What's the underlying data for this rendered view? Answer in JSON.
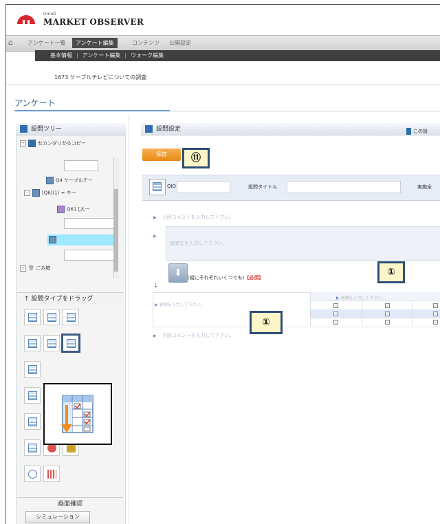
{
  "header": {
    "brand_small": "GmoD",
    "brand": "MARKET OBSERVER"
  },
  "nav": {
    "home_icon": "home-icon",
    "tabs": [
      {
        "label": "アンケート一覧",
        "active": false
      },
      {
        "label": "アンケート編集",
        "active": true
      },
      {
        "label": "コンテンツ",
        "active": false
      },
      {
        "label": "公開設定",
        "active": false
      }
    ],
    "subnav": [
      "基本情報",
      "アンケート編集",
      "ウォーク編集"
    ]
  },
  "survey_title": "1673 ケーブルテレビについての調査",
  "section_title": "アンケート",
  "left": {
    "tree_header": "設問ツリー",
    "copy_label": "セカンダリからコピー",
    "tree_items": [
      "Q4 ケーブルテー",
      "[Q6](1) = キー",
      "Q61 [大一"
    ],
    "trash_label": "ごみ箱",
    "drag_header": "設問タイプをドラッグ",
    "confirm_header": "画面確認",
    "simulation_button": "シミュレーション"
  },
  "right": {
    "header": "設問設定",
    "side_link": "この設",
    "save_label": "保存",
    "qid_label": "QID",
    "qtitle_label": "設問タイトル",
    "all_label": "実施全",
    "upper_comment_ph": "上段コメントを入力して下さい。",
    "question_text_ph": "設問文を入力して下さい。",
    "instruction": "(縦にそれぞれいくつでも)",
    "required": "【必須】",
    "column_header_ph": "表頭を入力して下さい。",
    "row_header_ph": "表側を入力して下さい。",
    "lower_comment_ph": "下段コメントを入力して下さい。"
  },
  "badges": {
    "save_badge": "⑪",
    "grid_badge_1": "①",
    "grid_badge_2": "①"
  }
}
